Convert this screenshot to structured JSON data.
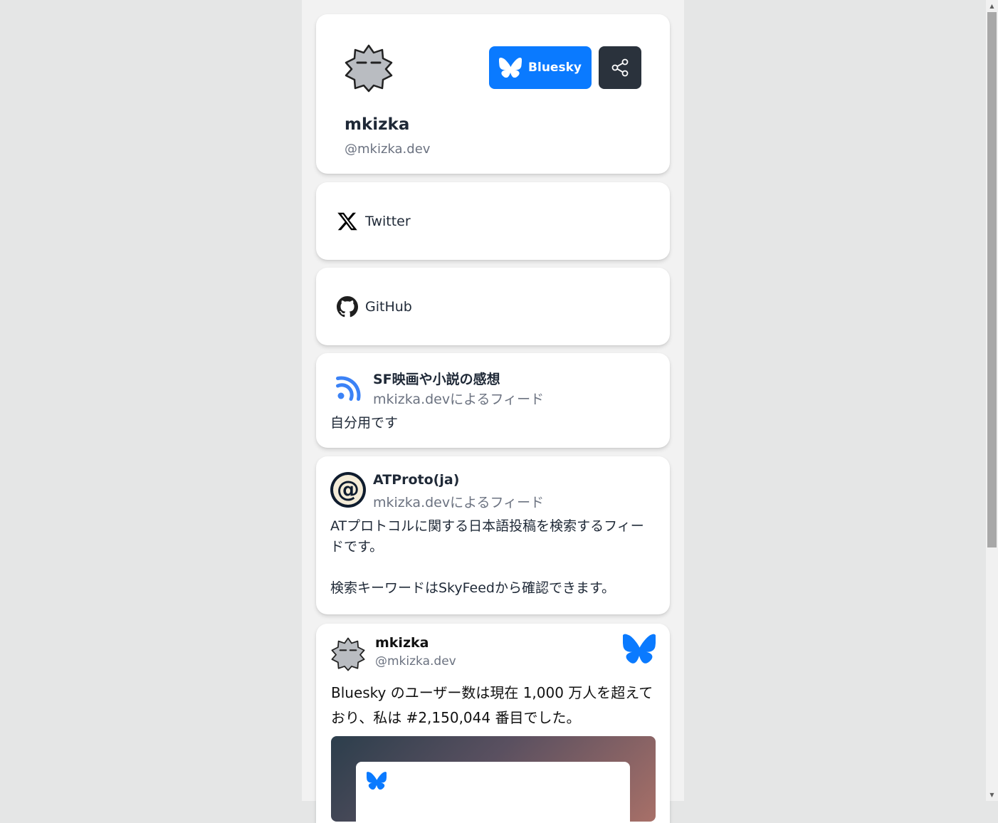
{
  "profile": {
    "name": "mkizka",
    "handle": "@mkizka.dev",
    "bluesky_button_label": "Bluesky"
  },
  "links": [
    {
      "label": "Twitter",
      "icon": "x-icon"
    },
    {
      "label": "GitHub",
      "icon": "github-icon"
    }
  ],
  "feeds": [
    {
      "title": "SF映画や小説の感想",
      "subtitle": "mkizka.devによるフィード",
      "description": "自分用です",
      "icon": "rss-icon"
    },
    {
      "title": "ATProto(ja)",
      "subtitle": "mkizka.devによるフィード",
      "description": "ATプロトコルに関する日本語投稿を検索するフィードです。\n\n検索キーワードはSkyFeedから確認できます。",
      "icon": "at-sign-icon"
    }
  ],
  "post": {
    "name": "mkizka",
    "handle": "@mkizka.dev",
    "text": "Bluesky のユーザー数は現在 1,000 万人を超えており、私は #2,150,044 番目でした。"
  },
  "colors": {
    "brand": "#0a7aff",
    "share_bg": "#2a323c",
    "muted_text": "#6b7280",
    "page_bg": "#e5e6e6"
  }
}
